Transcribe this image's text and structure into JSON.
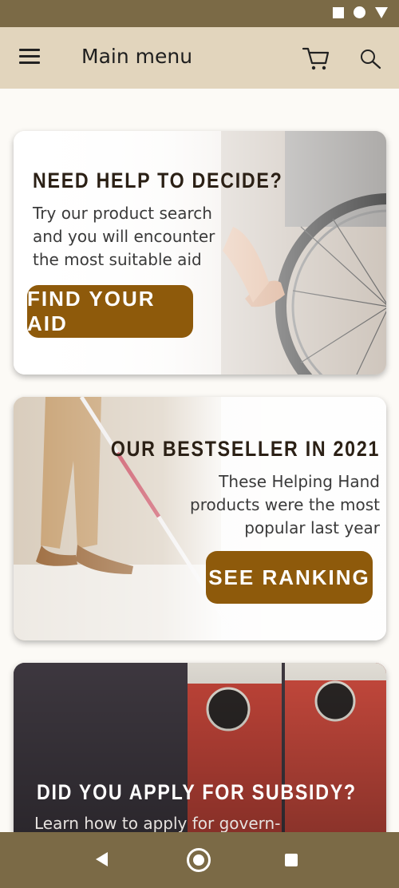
{
  "app_bar": {
    "title": "Main menu",
    "icons": [
      "menu-icon",
      "cart-icon",
      "search-icon"
    ]
  },
  "status_bar": {
    "icons": [
      "square-icon",
      "circle-icon",
      "triangle-icon"
    ]
  },
  "cards": [
    {
      "title": "NEED HELP TO DECIDE?",
      "text_lines": [
        "Try our product search",
        "and you will encounter",
        "the most suitable aid"
      ],
      "button_label": "FIND YOUR AID",
      "image": "wheelchair-photo"
    },
    {
      "title": "OUR BESTSELLER IN 2021",
      "text_lines": [
        "These Helping Hand",
        "products were the most",
        "popular last year"
      ],
      "button_label": "SEE RANKING",
      "image": "white-cane-photo"
    },
    {
      "title": "DID YOU APPLY FOR SUBSIDY?",
      "text_lines": [
        "Learn how to apply for govern-"
      ],
      "image": "red-binders-photo"
    }
  ],
  "nav_bar": {
    "icons": [
      "back-icon",
      "home-icon",
      "recents-icon"
    ]
  },
  "colors": {
    "status_bar": "#7b6a46",
    "app_bar": "#e2d5bd",
    "button": "#8e5a0b",
    "background": "#fcfaf6"
  }
}
